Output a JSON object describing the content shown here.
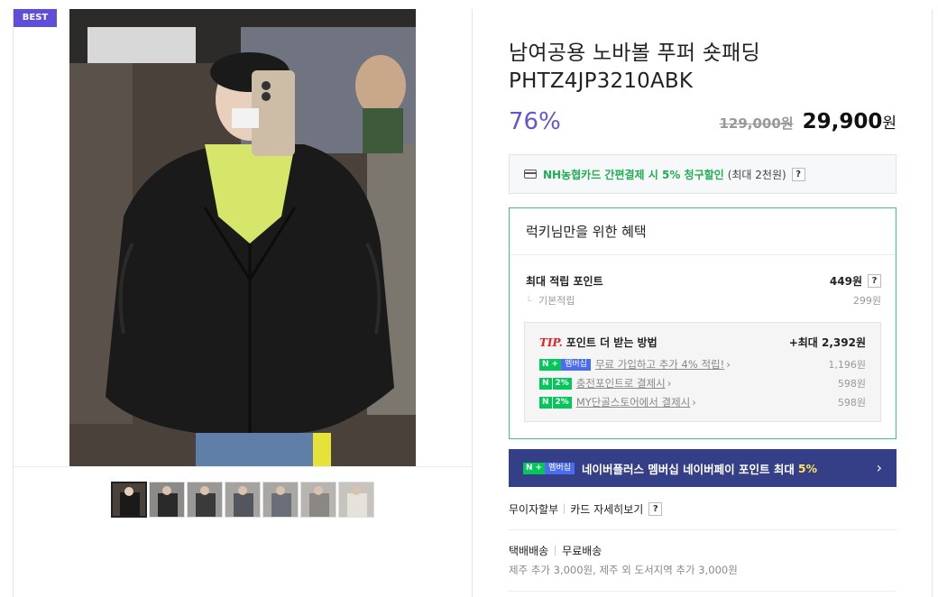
{
  "badge": "BEST",
  "product": {
    "title_line1": "남여공용 노바볼 푸퍼 숏패딩",
    "title_line2": "PHTZ4JP3210ABK",
    "discount": "76%",
    "original_price": "129,000원",
    "sale_price": "29,900",
    "sale_currency": "원"
  },
  "card_offer": {
    "highlight": "NH농협카드 간편결제 시 5% 청구할인",
    "note": "(최대 2천원)",
    "help": "?"
  },
  "benefit": {
    "heading": "럭키님만을 위한 혜택",
    "max_points_label": "최대 적립 포인트",
    "max_points_value": "449원",
    "help": "?",
    "basic_label": "기본적립",
    "basic_value": "299원",
    "tip": {
      "tip_word": "TIP.",
      "heading": "포인트 더 받는 방법",
      "max_value": "+최대 2,392원",
      "rows": [
        {
          "badge": "멤버십",
          "label": "무료 가입하고 추가 4% 적립!",
          "value": "1,196원"
        },
        {
          "badge": "2%",
          "label": "충전포인트로 결제시",
          "value": "598원"
        },
        {
          "badge": "2%",
          "label": "MY단골스토어에서 결제시",
          "value": "598원"
        }
      ]
    }
  },
  "naver_plus_banner": {
    "badge": "멤버십",
    "text": "네이버플러스 멤버십 네이버페이 포인트 최대",
    "highlight": "5%",
    "chevron": "›"
  },
  "installment": {
    "label": "무이자할부",
    "link": "카드 자세히보기",
    "help": "?"
  },
  "delivery": {
    "type": "택배배송",
    "fee": "무료배송",
    "note": "제주 추가 3,000원, 제주 외 도서지역 추가 3,000원"
  },
  "colors": {
    "discount": "#6355d8",
    "benefit_border": "#3fc38a",
    "banner_bg": "#343f88",
    "badge_bg": "#5f4fd8",
    "naver_green": "#03c75a"
  }
}
